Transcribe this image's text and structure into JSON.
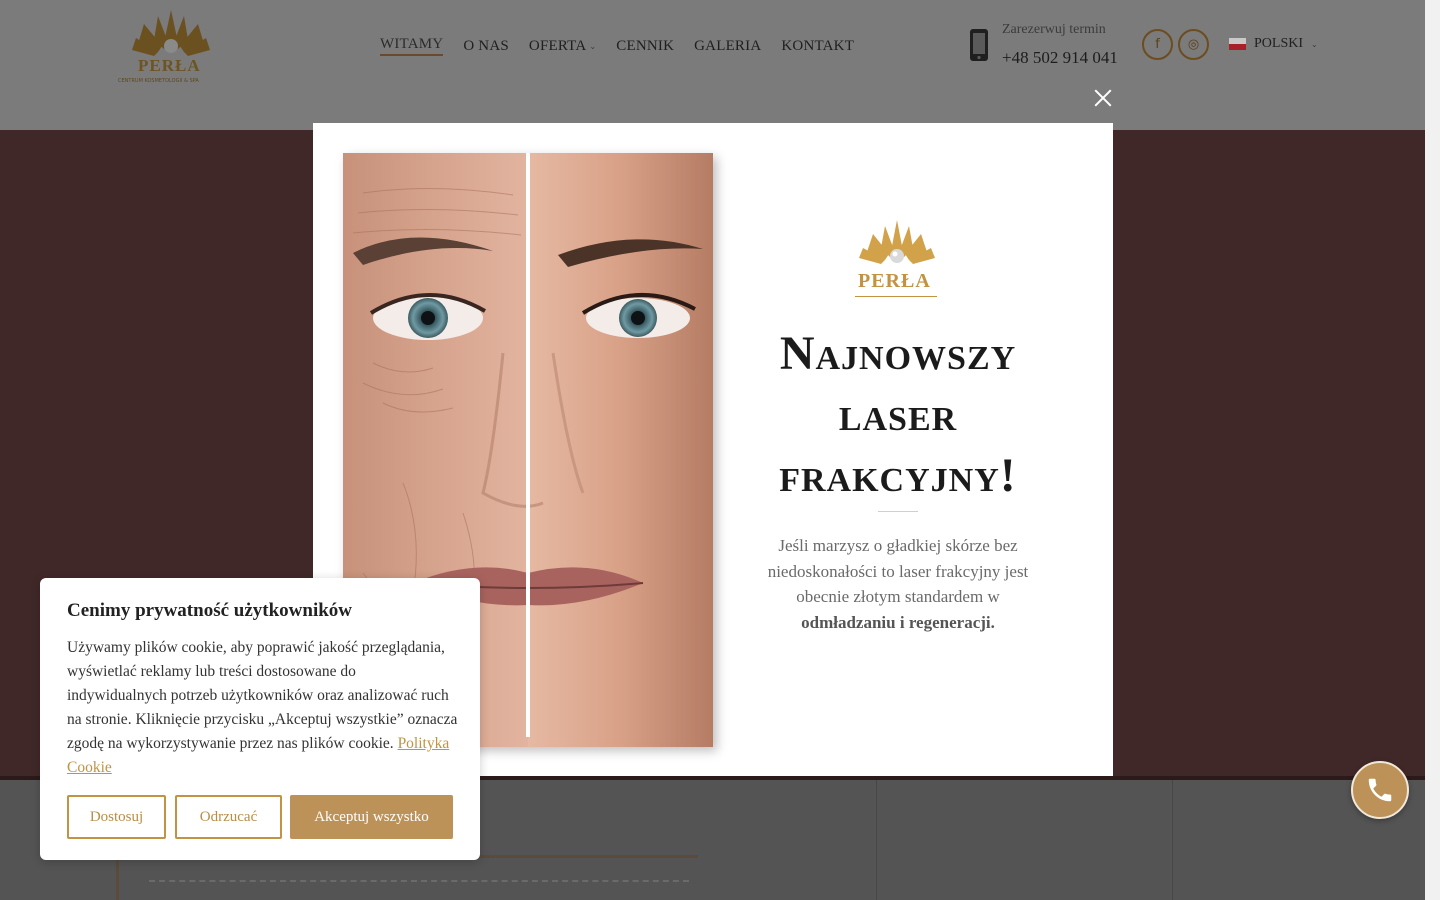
{
  "brand": {
    "name": "PERŁA",
    "tagline": "CENTRUM KOSMETOLOGII & SPA"
  },
  "nav": {
    "items": [
      {
        "label": "WITAMY",
        "active": true
      },
      {
        "label": "O NAS"
      },
      {
        "label": "OFERTA",
        "has_dropdown": true
      },
      {
        "label": "CENNIK"
      },
      {
        "label": "GALERIA"
      },
      {
        "label": "KONTAKT"
      }
    ]
  },
  "booking": {
    "label": "Zarezerwuj termin",
    "phone": "+48 502 914 041"
  },
  "social": {
    "facebook": "f",
    "instagram": "◎"
  },
  "language": {
    "label": "POLSKI"
  },
  "modal": {
    "brand": "PERŁA",
    "title": "Najnowszy laser frakcyjny!",
    "text_intro": "Jeśli marzysz o gładkiej skórze bez niedoskonałości to laser frakcyjny jest obecnie złotym standardem w ",
    "text_bold": "odmładzaniu i regeneracji."
  },
  "cookie": {
    "title": "Cenimy prywatność użytkowników",
    "body": "Używamy plików cookie, aby poprawić jakość przeglądania, wyświetlać reklamy lub treści dostosowane do indywidualnych potrzeb użytkowników oraz analizować ruch na stronie. Kliknięcie przycisku „Akceptuj wszystkie” oznacza zgodę na wykorzystywanie przez nas plików cookie.",
    "policy_link": "Polityka Cookie",
    "buttons": {
      "customize": "Dostosuj",
      "reject": "Odrzucać",
      "accept": "Akceptuj wszystko"
    }
  },
  "colors": {
    "accent": "#bd9259",
    "gold": "#c19342",
    "hero_bg": "#412828",
    "overlay": "#7b7b7b"
  },
  "icons": [
    "phone-device-icon",
    "facebook-icon",
    "instagram-icon",
    "flag-pl-icon",
    "close-icon",
    "phone-call-icon"
  ]
}
